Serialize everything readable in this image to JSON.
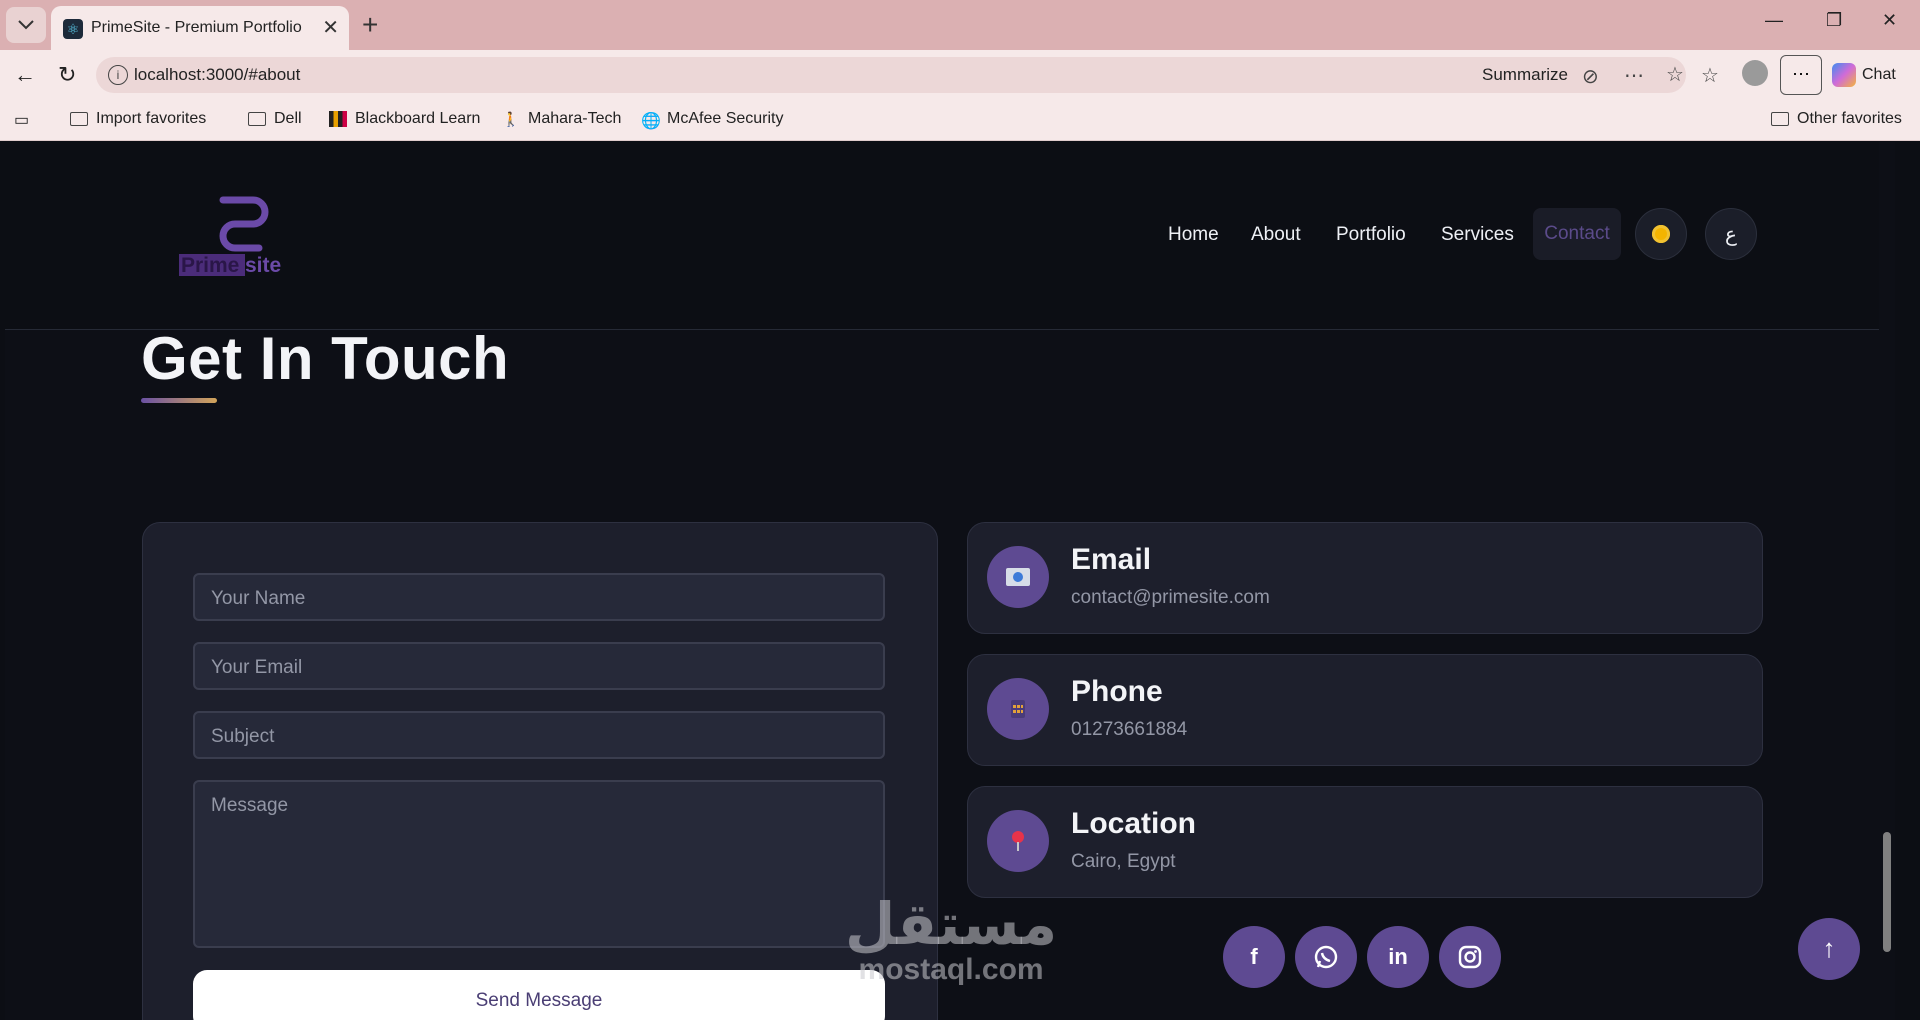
{
  "browser": {
    "tab_title": "PrimeSite - Premium Portfolio",
    "url": "localhost:3000/#about",
    "summarize_label": "Summarize",
    "chat_label": "Chat",
    "bookmarks": [
      "Import favorites",
      "Dell",
      "Blackboard Learn",
      "Mahara-Tech",
      "McAfee Security"
    ],
    "other_favorites": "Other favorites"
  },
  "site": {
    "logo_text_prime": "Prime",
    "logo_text_site": "site",
    "nav": [
      "Home",
      "About",
      "Portfolio",
      "Services",
      "Contact"
    ],
    "lang_toggle": "ع",
    "accent": "#5e4a92"
  },
  "contact": {
    "heading": "Get In Touch",
    "form": {
      "name_placeholder": "Your Name",
      "email_placeholder": "Your Email",
      "subject_placeholder": "Subject",
      "message_placeholder": "Message",
      "send_label": "Send Message"
    },
    "info": [
      {
        "title": "Email",
        "value": "contact@primesite.com",
        "icon": "envelope-icon"
      },
      {
        "title": "Phone",
        "value": "01273661884",
        "icon": "phone-icon"
      },
      {
        "title": "Location",
        "value": "Cairo, Egypt",
        "icon": "pin-icon"
      }
    ],
    "social": [
      "facebook-icon",
      "whatsapp-icon",
      "linkedin-icon",
      "instagram-icon"
    ]
  },
  "watermark": {
    "arabic": "مستقل",
    "latin": "mostaql.com"
  }
}
